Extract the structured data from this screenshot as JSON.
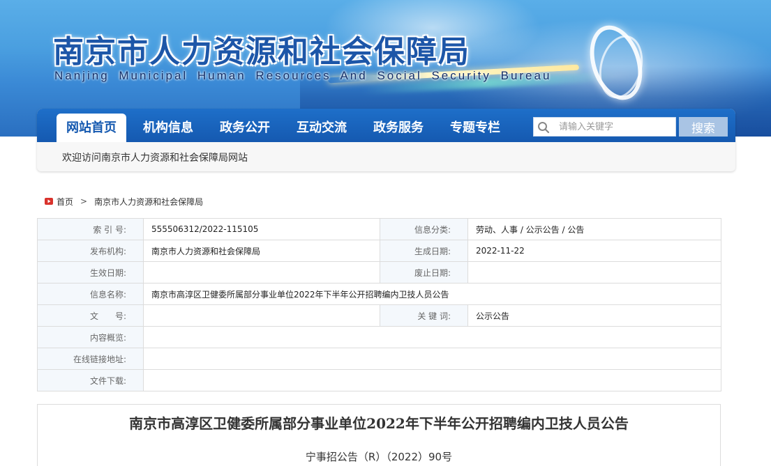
{
  "header": {
    "title": "南京市人力资源和社会保障局",
    "subtitle": "Nanjing Municipal Human Resources And Social Security Bureau"
  },
  "nav": {
    "items": [
      {
        "label": "网站首页",
        "active": true
      },
      {
        "label": "机构信息",
        "active": false
      },
      {
        "label": "政务公开",
        "active": false
      },
      {
        "label": "互动交流",
        "active": false
      },
      {
        "label": "政务服务",
        "active": false
      },
      {
        "label": "专题专栏",
        "active": false
      }
    ],
    "search": {
      "placeholder": "请输入关键字",
      "button_label": "搜索",
      "icon": "search-icon"
    },
    "welcome": "欢迎访问南京市人力资源和社会保障局网站"
  },
  "breadcrumb": {
    "icon": "home-icon",
    "items": [
      "首页",
      "南京市人力资源和社会保障局"
    ],
    "separator": ">"
  },
  "info": {
    "index_no": {
      "label": "索 引 号:",
      "value": "555506312/2022-115105"
    },
    "category": {
      "label": "信息分类:",
      "value": "劳动、人事 / 公示公告 / 公告"
    },
    "publisher": {
      "label": "发布机构:",
      "value": "南京市人力资源和社会保障局"
    },
    "created": {
      "label": "生成日期:",
      "value": "2022-11-22"
    },
    "effective": {
      "label": "生效日期:",
      "value": ""
    },
    "expired": {
      "label": "废止日期:",
      "value": ""
    },
    "name": {
      "label": "信息名称:",
      "value": "南京市高淳区卫健委所属部分事业单位2022年下半年公开招聘编内卫技人员公告"
    },
    "doc_no": {
      "label": "文　　号:",
      "value": ""
    },
    "keywords": {
      "label": "关 键 词:",
      "value": "公示公告"
    },
    "summary": {
      "label": "内容概览:",
      "value": ""
    },
    "link": {
      "label": "在线链接地址:",
      "value": ""
    },
    "download": {
      "label": "文件下载:",
      "value": ""
    }
  },
  "article": {
    "title": "南京市高淳区卫健委所属部分事业单位2022年下半年公开招聘编内卫技人员公告",
    "doc_number": "宁事招公告（R）（2022）90号"
  },
  "colors": {
    "nav_blue": "#1559b0",
    "title_blue": "#1d56a8",
    "label_bg": "#f4f8fc",
    "search_button": "#a9c4e4"
  }
}
